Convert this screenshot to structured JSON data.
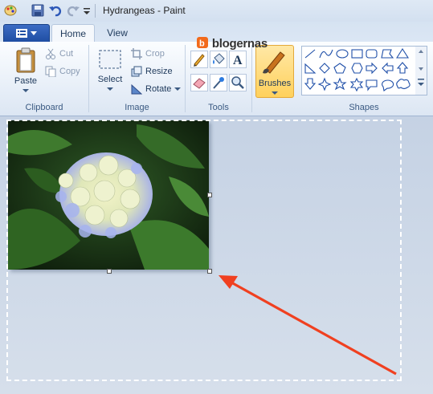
{
  "window": {
    "title": "Hydrangeas - Paint"
  },
  "tabs": {
    "home": "Home",
    "view": "View"
  },
  "watermark": {
    "text": "blogernas"
  },
  "clipboard": {
    "paste": "Paste",
    "cut": "Cut",
    "copy": "Copy",
    "label": "Clipboard"
  },
  "image": {
    "select": "Select",
    "crop": "Crop",
    "resize": "Resize",
    "rotate": "Rotate",
    "label": "Image"
  },
  "tools": {
    "label": "Tools",
    "icons": [
      "pencil-icon",
      "fill-icon",
      "text-icon",
      "eraser-icon",
      "color-picker-icon",
      "magnifier-icon"
    ]
  },
  "brushes": {
    "label": "Brushes"
  },
  "shapes": {
    "label": "Shapes"
  },
  "colors": {
    "accent": "#f04020",
    "selection": "#ffffff",
    "ribbon": "#e5edf7"
  }
}
